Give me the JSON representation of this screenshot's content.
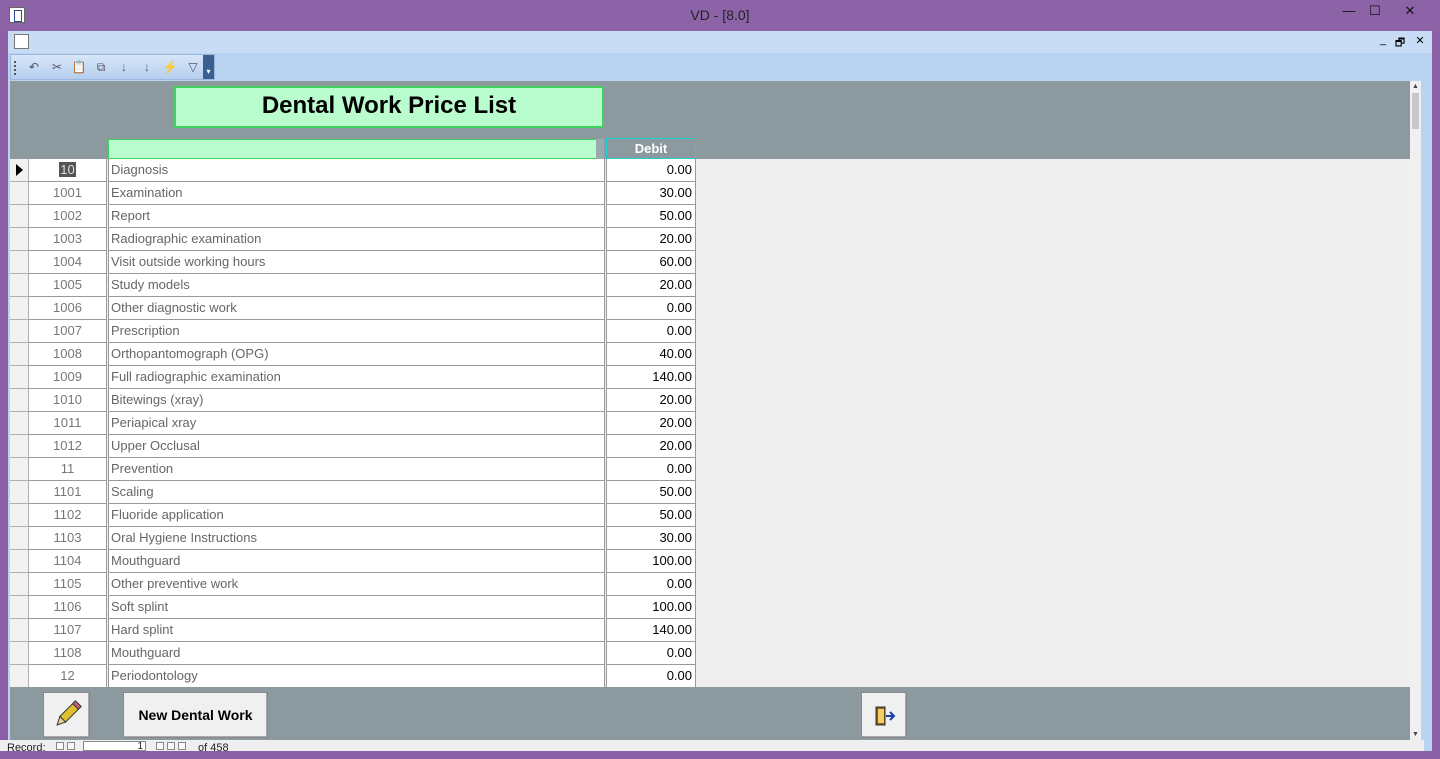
{
  "window": {
    "title": "VD - [8.0]",
    "minimize": "—",
    "maximize": "☐",
    "close": "✕"
  },
  "mdi": {
    "minimize": "_",
    "restore": "🗗",
    "close": "✕"
  },
  "toolbar": {
    "buttons": [
      {
        "name": "undo-icon",
        "glyph": "↶"
      },
      {
        "name": "cut-icon",
        "glyph": "✂"
      },
      {
        "name": "paste-icon",
        "glyph": "📋"
      },
      {
        "name": "copy-icon",
        "glyph": "⧉"
      },
      {
        "name": "sort-ascending-icon",
        "glyph": "↓"
      },
      {
        "name": "sort-descending-icon",
        "glyph": "↓"
      },
      {
        "name": "filter-by-selection-icon",
        "glyph": "⚡"
      },
      {
        "name": "filter-icon",
        "glyph": "▽"
      }
    ],
    "dropdown": "▾"
  },
  "form": {
    "title": "Dental Work Price List",
    "header": {
      "description": "",
      "debit": "Debit"
    },
    "rows": [
      {
        "code": "10",
        "description": "Diagnosis",
        "debit": "0.00",
        "current": true
      },
      {
        "code": "1001",
        "description": "Examination",
        "debit": "30.00"
      },
      {
        "code": "1002",
        "description": "Report",
        "debit": "50.00"
      },
      {
        "code": "1003",
        "description": "Radiographic examination",
        "debit": "20.00"
      },
      {
        "code": "1004",
        "description": "Visit outside working hours",
        "debit": "60.00"
      },
      {
        "code": "1005",
        "description": "Study models",
        "debit": "20.00"
      },
      {
        "code": "1006",
        "description": "Other diagnostic work",
        "debit": "0.00"
      },
      {
        "code": "1007",
        "description": "Prescription",
        "debit": "0.00"
      },
      {
        "code": "1008",
        "description": "Orthopantomograph (OPG)",
        "debit": "40.00"
      },
      {
        "code": "1009",
        "description": "Full radiographic examination",
        "debit": "140.00"
      },
      {
        "code": "1010",
        "description": "Bitewings (xray)",
        "debit": "20.00"
      },
      {
        "code": "1011",
        "description": "Periapical xray",
        "debit": "20.00"
      },
      {
        "code": "1012",
        "description": "Upper Occlusal",
        "debit": "20.00"
      },
      {
        "code": "11",
        "description": "Prevention",
        "debit": "0.00"
      },
      {
        "code": "1101",
        "description": "Scaling",
        "debit": "50.00"
      },
      {
        "code": "1102",
        "description": "Fluoride application",
        "debit": "50.00"
      },
      {
        "code": "1103",
        "description": "Oral Hygiene Instructions",
        "debit": "30.00"
      },
      {
        "code": "1104",
        "description": "Mouthguard",
        "debit": "100.00"
      },
      {
        "code": "1105",
        "description": "Other preventive work",
        "debit": "0.00"
      },
      {
        "code": "1106",
        "description": "Soft splint",
        "debit": "100.00"
      },
      {
        "code": "1107",
        "description": "Hard splint",
        "debit": "140.00"
      },
      {
        "code": "1108",
        "description": "Mouthguard",
        "debit": "0.00"
      },
      {
        "code": "12",
        "description": "Periodontology",
        "debit": "0.00"
      }
    ],
    "buttons": {
      "new_dental_work": "New Dental Work"
    }
  },
  "navigation": {
    "label": "Record:",
    "current": "1",
    "of_text": "of 458"
  },
  "colors": {
    "title_bar": "#8d63a8",
    "form_bg": "#8c9aa0",
    "title_fill": "#b9fcce",
    "title_border": "#3fd35c"
  }
}
